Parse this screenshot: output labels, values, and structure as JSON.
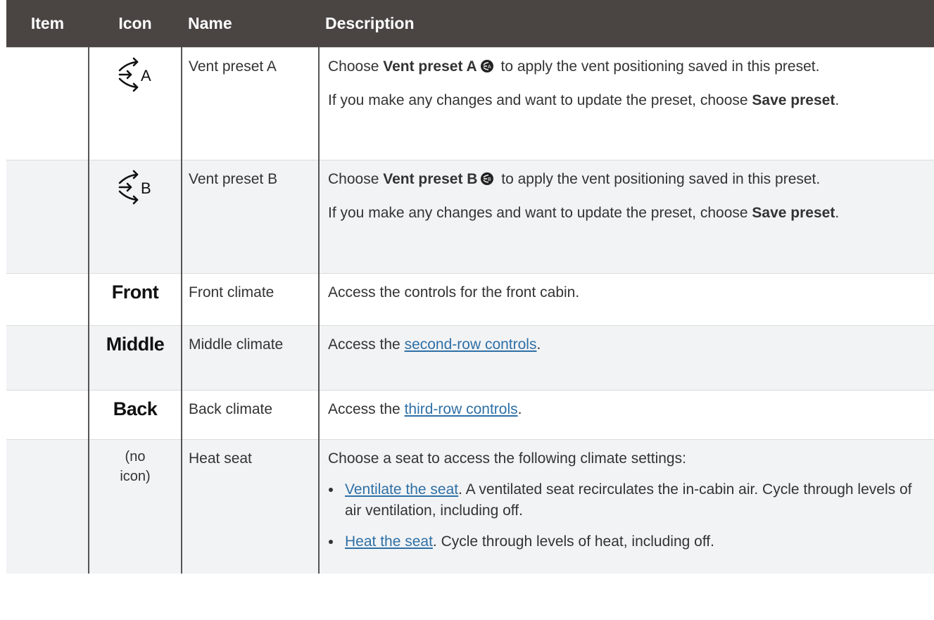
{
  "headers": {
    "item": "Item",
    "icon": "Icon",
    "name": "Name",
    "description": "Description"
  },
  "rows": [
    {
      "icon_type": "vent-preset-icon",
      "icon_letter": "A",
      "name": "Vent preset A",
      "paragraphs": [
        {
          "before": "Choose ",
          "bold": "Vent preset A",
          "after": " to apply the vent positioning saved in this preset."
        },
        {
          "before": "If you make any changes and want to update the preset, choose ",
          "bold": "Save preset",
          "after": "."
        }
      ]
    },
    {
      "icon_type": "vent-preset-icon",
      "icon_letter": "B",
      "name": "Vent preset B",
      "paragraphs": [
        {
          "before": "Choose ",
          "bold": "Vent preset B",
          "after": " to apply the vent positioning saved in this preset."
        },
        {
          "before": "If you make any changes and want to update the preset, choose ",
          "bold": "Save preset",
          "after": "."
        }
      ]
    },
    {
      "icon_word": "Front",
      "name": "Front climate",
      "text": "Access the controls for the front cabin."
    },
    {
      "icon_word": "Middle",
      "name": "Middle climate",
      "before": "Access the ",
      "link": "second-row controls",
      "after": "."
    },
    {
      "icon_word": "Back",
      "name": "Back climate",
      "before": "Access the ",
      "link": "third-row controls",
      "after": "."
    },
    {
      "icon_text": "(no icon)",
      "name": "Heat seat",
      "intro": "Choose a seat to access the following climate settings:",
      "bullets": [
        {
          "link": "Ventilate the seat",
          "after": ". A ventilated seat recirculates the in-cabin air. Cycle through levels of air ventilation, including off."
        },
        {
          "link": "Heat the seat",
          "after": ". Cycle through levels of heat, including off."
        }
      ]
    }
  ],
  "colors": {
    "header_bg": "#4a4543",
    "alt_row_bg": "#f2f3f5",
    "link": "#2e70a6",
    "text": "#333333"
  }
}
